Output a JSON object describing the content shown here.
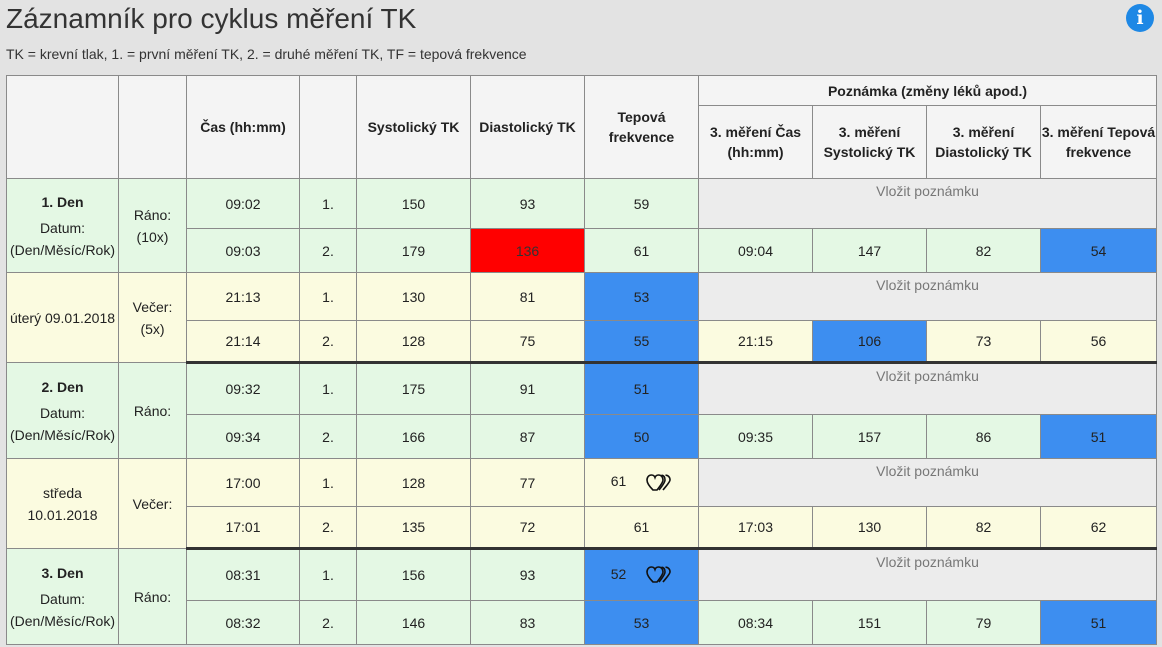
{
  "page": {
    "title": "Záznamník pro cyklus měření TK",
    "legend": "TK = krevní tlak, 1. = první měření TK, 2. = druhé měření TK, TF = tepová frekvence",
    "info_icon": "info-icon"
  },
  "table": {
    "headers": {
      "time": "Čas (hh:mm)",
      "systolic": "Systolický TK",
      "diastolic": "Diastolický TK",
      "pulse": "Tepová frekvence",
      "note_group": "Poznámka (změny léků apod.)",
      "third_time": "3. měření Čas (hh:mm)",
      "third_systolic": "3. měření Systolický TK",
      "third_diastolic": "3. měření Diastolický TK",
      "third_pulse": "3. měření Tepová frekvence"
    },
    "note_placeholder": "Vložit poznámku",
    "colors": {
      "green_row": "#e4f8e4",
      "yellow_row": "#fbfbe0",
      "alert_red": "#ff0000",
      "alert_blue": "#3d8ef0",
      "note_bg": "#ececec"
    },
    "days": [
      {
        "label": "1. Den",
        "date_label": "Datum: (Den/Měsíc/Rok)",
        "morning_label": "Ráno: (10x)",
        "weekday_date": "úterý 09.01.2018",
        "evening_label": "Večer: (5x)",
        "morning": {
          "m1": {
            "time": "09:02",
            "no": "1.",
            "sys": "150",
            "dia": "93",
            "pulse": "59"
          },
          "m2": {
            "time": "09:03",
            "no": "2.",
            "sys": "179",
            "dia": "136",
            "pulse": "61"
          },
          "third": {
            "time": "09:04",
            "sys": "147",
            "dia": "82",
            "pulse": "54"
          }
        },
        "evening": {
          "m1": {
            "time": "21:13",
            "no": "1.",
            "sys": "130",
            "dia": "81",
            "pulse": "53"
          },
          "m2": {
            "time": "21:14",
            "no": "2.",
            "sys": "128",
            "dia": "75",
            "pulse": "55"
          },
          "third": {
            "time": "21:15",
            "sys": "106",
            "dia": "73",
            "pulse": "56"
          }
        }
      },
      {
        "label": "2. Den",
        "date_label": "Datum: (Den/Měsíc/Rok)",
        "morning_label": "Ráno:",
        "weekday_date": "středa 10.01.2018",
        "evening_label": "Večer:",
        "morning": {
          "m1": {
            "time": "09:32",
            "no": "1.",
            "sys": "175",
            "dia": "91",
            "pulse": "51"
          },
          "m2": {
            "time": "09:34",
            "no": "2.",
            "sys": "166",
            "dia": "87",
            "pulse": "50"
          },
          "third": {
            "time": "09:35",
            "sys": "157",
            "dia": "86",
            "pulse": "51"
          }
        },
        "evening": {
          "m1": {
            "time": "17:00",
            "no": "1.",
            "sys": "128",
            "dia": "77",
            "pulse": "61",
            "heart_icon": "heartbeat-icon"
          },
          "m2": {
            "time": "17:01",
            "no": "2.",
            "sys": "135",
            "dia": "72",
            "pulse": "61"
          },
          "third": {
            "time": "17:03",
            "sys": "130",
            "dia": "82",
            "pulse": "62"
          }
        }
      },
      {
        "label": "3. Den",
        "date_label": "Datum: (Den/Měsíc/Rok)",
        "morning_label": "Ráno:",
        "morning": {
          "m1": {
            "time": "08:31",
            "no": "1.",
            "sys": "156",
            "dia": "93",
            "pulse": "52",
            "heart_icon": "heartbeat-icon"
          },
          "m2": {
            "time": "08:32",
            "no": "2.",
            "sys": "146",
            "dia": "83",
            "pulse": "53"
          },
          "third": {
            "time": "08:34",
            "sys": "151",
            "dia": "79",
            "pulse": "51"
          }
        }
      }
    ]
  }
}
